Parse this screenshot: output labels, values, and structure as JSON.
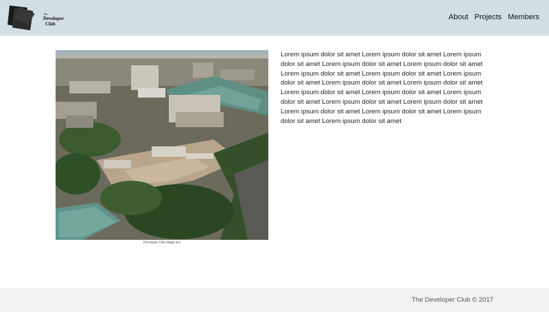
{
  "header": {
    "logo": {
      "small_text": "The",
      "line1": "Developer",
      "line2": "Club"
    },
    "nav": [
      {
        "label": "About"
      },
      {
        "label": "Projects"
      },
      {
        "label": "Members"
      }
    ],
    "background_color": "#d3e0e3"
  },
  "main": {
    "image": {
      "caption": "Developer Club image text",
      "icon": "city-aerial-photo"
    },
    "paragraph": "Lorem ipsum dolor sit amet Lorem ipsum dolor sit amet Lorem ipsum dolor sit amet Lorem ipsum dolor sit amet Lorem ipsum dolor sit amet Lorem ipsum dolor sit amet Lorem ipsum dolor sit amet Lorem ipsum dolor sit amet Lorem ipsum dolor sit amet Lorem ipsum dolor sit amet Lorem ipsum dolor sit amet Lorem ipsum dolor sit amet Lorem ipsum dolor sit amet Lorem ipsum dolor sit amet Lorem ipsum dolor sit amet Lorem ipsum dolor sit amet Lorem ipsum dolor sit amet Lorem ipsum dolor sit amet Lorem ipsum dolor sit amet"
  },
  "footer": {
    "text": "The Developer Club © 2017",
    "background_color": "#f2f2f2"
  }
}
